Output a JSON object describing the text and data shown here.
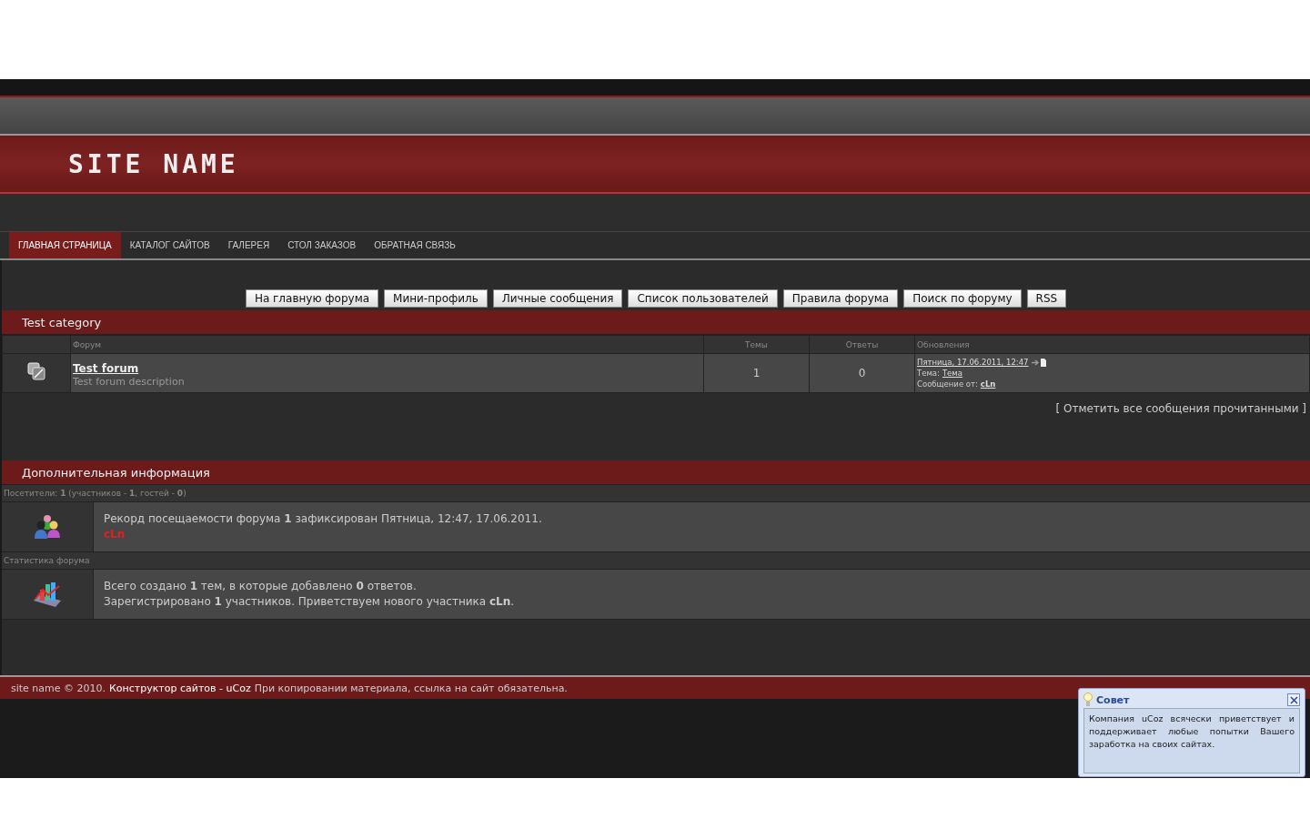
{
  "header": {
    "site_name": "SITE NAME"
  },
  "nav": [
    {
      "label": "ГЛАВНАЯ СТРАНИЦА",
      "selected": true
    },
    {
      "label": "КАТАЛОГ САЙТОВ",
      "selected": false
    },
    {
      "label": "ГАЛЕРЕЯ",
      "selected": false
    },
    {
      "label": "СТОЛ ЗАКАЗОВ",
      "selected": false
    },
    {
      "label": "ОБРАТНАЯ СВЯЗЬ",
      "selected": false
    }
  ],
  "forum_buttons": [
    "На главную форума",
    "Мини-профиль",
    "Личные сообщения",
    "Список пользователей",
    "Правила форума",
    "Поиск по форуму",
    "RSS"
  ],
  "category": {
    "title": "Test category",
    "columns": [
      "Форум",
      "Темы",
      "Ответы",
      "Обновления"
    ],
    "forums": [
      {
        "name": "Test forum",
        "description": "Test forum description",
        "topics": "1",
        "replies": "0",
        "last_date": "Пятница, 17.06.2011, 12:47",
        "topic_label": "Тема:",
        "topic": "Тема",
        "author_label": "Сообщение от:",
        "author": "cLn"
      }
    ]
  },
  "mark_read": "[ Отметить все сообщения прочитанными ]",
  "info": {
    "title": "Дополнительная информация",
    "sections": [
      {
        "kind": "users",
        "heading": "Посетители: **1**  (участников - **1**, гостей - **0**)",
        "lines": [
          "Рекорд посещаемости форума **1** зафиксирован Пятница, 12:47, 17.06.2011."
        ],
        "user": "cLn"
      },
      {
        "kind": "stats",
        "heading": "Статистика форума",
        "lines": [
          "Всего создано **1** тем, в которые добавлено **0** ответов.",
          "Зарегистрировано **1** участников. Приветствуем нового участника **cLn**."
        ]
      }
    ]
  },
  "footer": {
    "copyright": "site name © 2010.",
    "link": "Конструктор сайтов - uCoz",
    "notice": "При копировании материала, ссылка на сайт обязательна."
  },
  "tip": {
    "title": "Совет",
    "text": "Компания uCoz всячески приветствует и поддерживает любые попытки Вашего заработка на своих сайтах."
  }
}
